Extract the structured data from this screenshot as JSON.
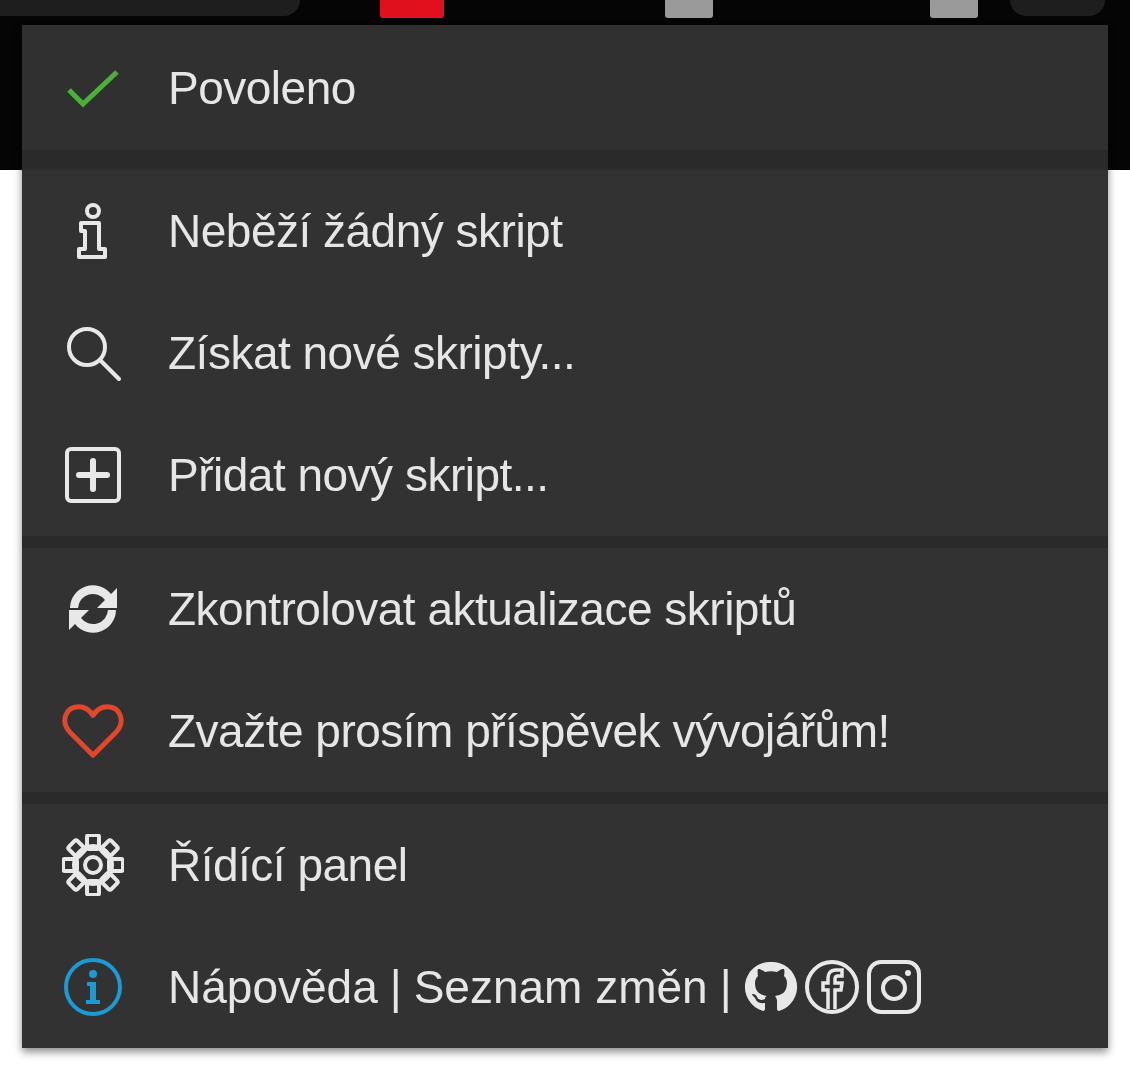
{
  "toolbar": {
    "badges": [
      {
        "color": "#e0101c"
      },
      {
        "color": "#9a9a9a"
      },
      {
        "color": "#9a9a9a"
      }
    ]
  },
  "menu": {
    "sections": [
      {
        "items": [
          {
            "kind": "toggle",
            "label": "Povoleno",
            "checked": true
          }
        ]
      },
      {
        "items": [
          {
            "kind": "status",
            "label": "Neběží žádný skript"
          },
          {
            "kind": "search",
            "label": "Získat nové skripty..."
          },
          {
            "kind": "add",
            "label": "Přidat nový skript..."
          }
        ]
      },
      {
        "items": [
          {
            "kind": "update",
            "label": "Zkontrolovat aktualizace skriptů"
          },
          {
            "kind": "donate",
            "label": "Zvažte prosím příspěvek vývojářům!"
          }
        ]
      },
      {
        "items": [
          {
            "kind": "dashboard",
            "label": "Řídící panel"
          },
          {
            "kind": "links",
            "parts": [
              {
                "kind": "link",
                "label": "Nápověda"
              },
              {
                "kind": "separator",
                "label": "|"
              },
              {
                "kind": "link",
                "label": "Seznam změn"
              },
              {
                "kind": "separator",
                "label": "|"
              },
              {
                "kind": "github"
              },
              {
                "kind": "facebook"
              },
              {
                "kind": "instagram"
              }
            ]
          }
        ]
      }
    ]
  }
}
